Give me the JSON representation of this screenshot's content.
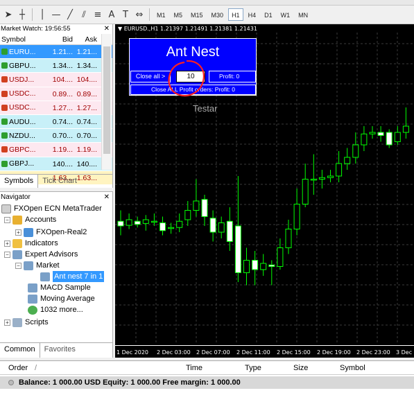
{
  "toolbar": {
    "timeframes": [
      "M1",
      "M5",
      "M15",
      "M30",
      "H1",
      "H4",
      "D1",
      "W1",
      "MN"
    ],
    "active_timeframe": "H1"
  },
  "market_watch": {
    "title": "Market Watch: 19:56:55",
    "columns": [
      "Symbol",
      "Bid",
      "Ask"
    ],
    "rows": [
      {
        "symbol": "EURU...",
        "bid": "1.21...",
        "ask": "1.21...",
        "dir": "up",
        "bg": "#3399ff",
        "fg": "#ffffff"
      },
      {
        "symbol": "GBPU...",
        "bid": "1.34...",
        "ask": "1.34...",
        "dir": "up",
        "bg": "#c8f0f8",
        "fg": "#000000"
      },
      {
        "symbol": "USDJ...",
        "bid": "104....",
        "ask": "104....",
        "dir": "down",
        "bg": "#fde8f0",
        "fg": "#a00000"
      },
      {
        "symbol": "USDC...",
        "bid": "0.89...",
        "ask": "0.89...",
        "dir": "down",
        "bg": "#fde8f0",
        "fg": "#a00000"
      },
      {
        "symbol": "USDC...",
        "bid": "1.27...",
        "ask": "1.27...",
        "dir": "down",
        "bg": "#fde8f0",
        "fg": "#a00000"
      },
      {
        "symbol": "AUDU...",
        "bid": "0.74...",
        "ask": "0.74...",
        "dir": "up",
        "bg": "#c8f0f8",
        "fg": "#000000"
      },
      {
        "symbol": "NZDU...",
        "bid": "0.70...",
        "ask": "0.70...",
        "dir": "up",
        "bg": "#c8f0f8",
        "fg": "#000000"
      },
      {
        "symbol": "GBPC...",
        "bid": "1.19...",
        "ask": "1.19...",
        "dir": "down",
        "bg": "#fde8f0",
        "fg": "#a00000"
      },
      {
        "symbol": "GBPJ...",
        "bid": "140....",
        "ask": "140....",
        "dir": "up",
        "bg": "#c8f0f8",
        "fg": "#000000"
      },
      {
        "symbol": "EURA...",
        "bid": "1.63...",
        "ask": "1.63...",
        "dir": "down",
        "bg": "#fff4c0",
        "fg": "#a00000"
      }
    ],
    "tabs": [
      "Symbols",
      "Tick Chart"
    ]
  },
  "navigator": {
    "title": "Navigator",
    "root": "FXOpen ECN MetaTrader",
    "accounts": "Accounts",
    "account": "FXOpen-Real2",
    "indicators": "Indicators",
    "experts": "Expert Advisors",
    "market": "Market",
    "ant": "Ant nest 7 in 1",
    "macd": "MACD Sample",
    "ma": "Moving Average",
    "more": "1032 more...",
    "scripts": "Scripts",
    "tabs": [
      "Common",
      "Favorites"
    ]
  },
  "chart": {
    "title": "▼ EURUSD.,H1  1.21397 1.21491 1.21381 1.21431",
    "panel_title": "Ant Nest",
    "close_all": "Close all >",
    "qty": "10",
    "profit": "Profit: 0",
    "close_profit": "Close ALL Profit orders: Profit: 0",
    "testar": "Testar",
    "x_labels": [
      "1 Dec 2020",
      "2 Dec 03:00",
      "2 Dec 07:00",
      "2 Dec 11:00",
      "2 Dec 15:00",
      "2 Dec 19:00",
      "2 Dec 23:00",
      "3 Dec"
    ],
    "annotation_color": "#ff2020"
  },
  "chart_data": {
    "type": "candlestick",
    "symbol": "EURUSD.",
    "timeframe": "H1",
    "ohlc_last": {
      "open": 1.21397,
      "high": 1.21491,
      "low": 1.21381,
      "close": 1.21431
    },
    "candles": [
      {
        "o": 0.395,
        "c": 0.38,
        "h": 0.43,
        "l": 0.35
      },
      {
        "o": 0.382,
        "c": 0.4,
        "h": 0.42,
        "l": 0.37
      },
      {
        "o": 0.395,
        "c": 0.385,
        "h": 0.41,
        "l": 0.375
      },
      {
        "o": 0.388,
        "c": 0.4,
        "h": 0.415,
        "l": 0.365
      },
      {
        "o": 0.395,
        "c": 0.395,
        "h": 0.42,
        "l": 0.38
      },
      {
        "o": 0.39,
        "c": 0.365,
        "h": 0.41,
        "l": 0.35
      },
      {
        "o": 0.375,
        "c": 0.375,
        "h": 0.39,
        "l": 0.355
      },
      {
        "o": 0.375,
        "c": 0.395,
        "h": 0.42,
        "l": 0.36
      },
      {
        "o": 0.4,
        "c": 0.43,
        "h": 0.46,
        "l": 0.38
      },
      {
        "o": 0.43,
        "c": 0.46,
        "h": 0.53,
        "l": 0.41
      },
      {
        "o": 0.465,
        "c": 0.41,
        "h": 0.48,
        "l": 0.38
      },
      {
        "o": 0.405,
        "c": 0.36,
        "h": 0.43,
        "l": 0.33
      },
      {
        "o": 0.36,
        "c": 0.39,
        "h": 0.41,
        "l": 0.34
      },
      {
        "o": 0.395,
        "c": 0.33,
        "h": 0.44,
        "l": 0.3
      },
      {
        "o": 0.38,
        "c": 0.23,
        "h": 0.54,
        "l": 0.2
      },
      {
        "o": 0.23,
        "c": 0.27,
        "h": 0.31,
        "l": 0.19
      },
      {
        "o": 0.27,
        "c": 0.24,
        "h": 0.3,
        "l": 0.19
      },
      {
        "o": 0.24,
        "c": 0.26,
        "h": 0.29,
        "l": 0.22
      },
      {
        "o": 0.255,
        "c": 0.25,
        "h": 0.27,
        "l": 0.19
      },
      {
        "o": 0.25,
        "c": 0.31,
        "h": 0.34,
        "l": 0.24
      },
      {
        "o": 0.31,
        "c": 0.37,
        "h": 0.4,
        "l": 0.29
      },
      {
        "o": 0.37,
        "c": 0.45,
        "h": 0.5,
        "l": 0.35
      },
      {
        "o": 0.45,
        "c": 0.53,
        "h": 0.58,
        "l": 0.44
      },
      {
        "o": 0.53,
        "c": 0.53,
        "h": 0.61,
        "l": 0.48
      },
      {
        "o": 0.53,
        "c": 0.535,
        "h": 0.56,
        "l": 0.5
      },
      {
        "o": 0.535,
        "c": 0.54,
        "h": 0.56,
        "l": 0.52
      },
      {
        "o": 0.54,
        "c": 0.58,
        "h": 0.62,
        "l": 0.52
      },
      {
        "o": 0.58,
        "c": 0.6,
        "h": 0.63,
        "l": 0.56
      },
      {
        "o": 0.6,
        "c": 0.64,
        "h": 0.68,
        "l": 0.58
      },
      {
        "o": 0.64,
        "c": 0.675,
        "h": 0.7,
        "l": 0.62
      },
      {
        "o": 0.675,
        "c": 0.68,
        "h": 0.7,
        "l": 0.66
      },
      {
        "o": 0.68,
        "c": 0.67,
        "h": 0.7,
        "l": 0.65
      },
      {
        "o": 0.68,
        "c": 0.64,
        "h": 0.69,
        "l": 0.63
      },
      {
        "o": 0.65,
        "c": 0.68,
        "h": 0.7,
        "l": 0.64
      },
      {
        "o": 0.68,
        "c": 0.7,
        "h": 0.76,
        "l": 0.66
      }
    ]
  },
  "terminal": {
    "columns": [
      "Order",
      "/",
      "Time",
      "Type",
      "Size",
      "Symbol"
    ],
    "balance": "Balance: 1 000.00 USD  Equity: 1 000.00  Free margin: 1 000.00"
  }
}
